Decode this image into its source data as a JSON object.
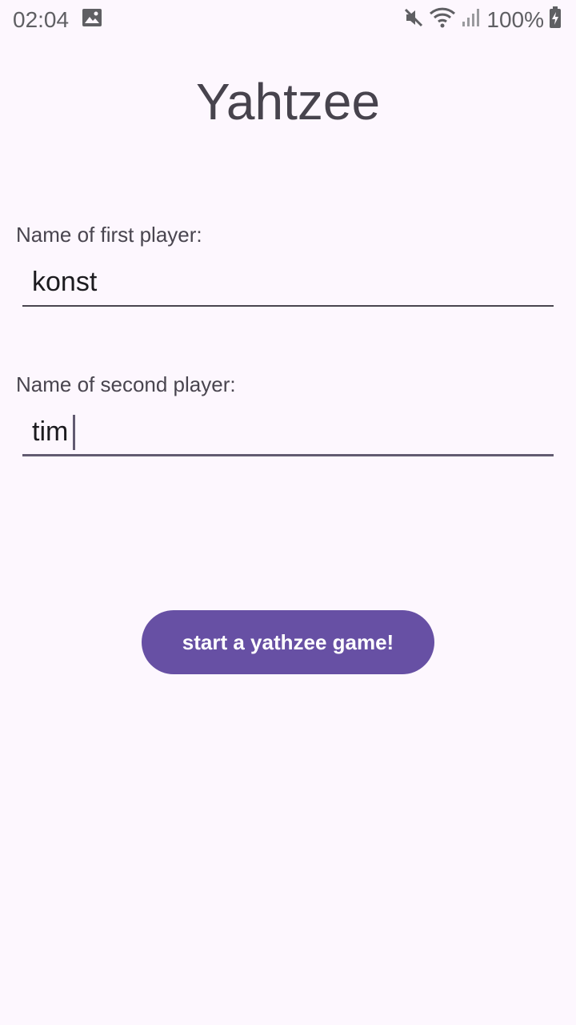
{
  "status_bar": {
    "time": "02:04",
    "battery": "100%",
    "icons": [
      "image-icon",
      "mute-icon",
      "wifi-icon",
      "signal-icon",
      "battery-charging-icon"
    ]
  },
  "title": "Yahtzee",
  "first_player": {
    "label": "Name of first player:",
    "value": "konst"
  },
  "second_player": {
    "label": "Name of second player:",
    "value": "tim"
  },
  "start_button": {
    "label": "start a yathzee game!"
  },
  "colors": {
    "background": "#FDF7FE",
    "accent": "#6750A4",
    "text": "#49454F"
  }
}
